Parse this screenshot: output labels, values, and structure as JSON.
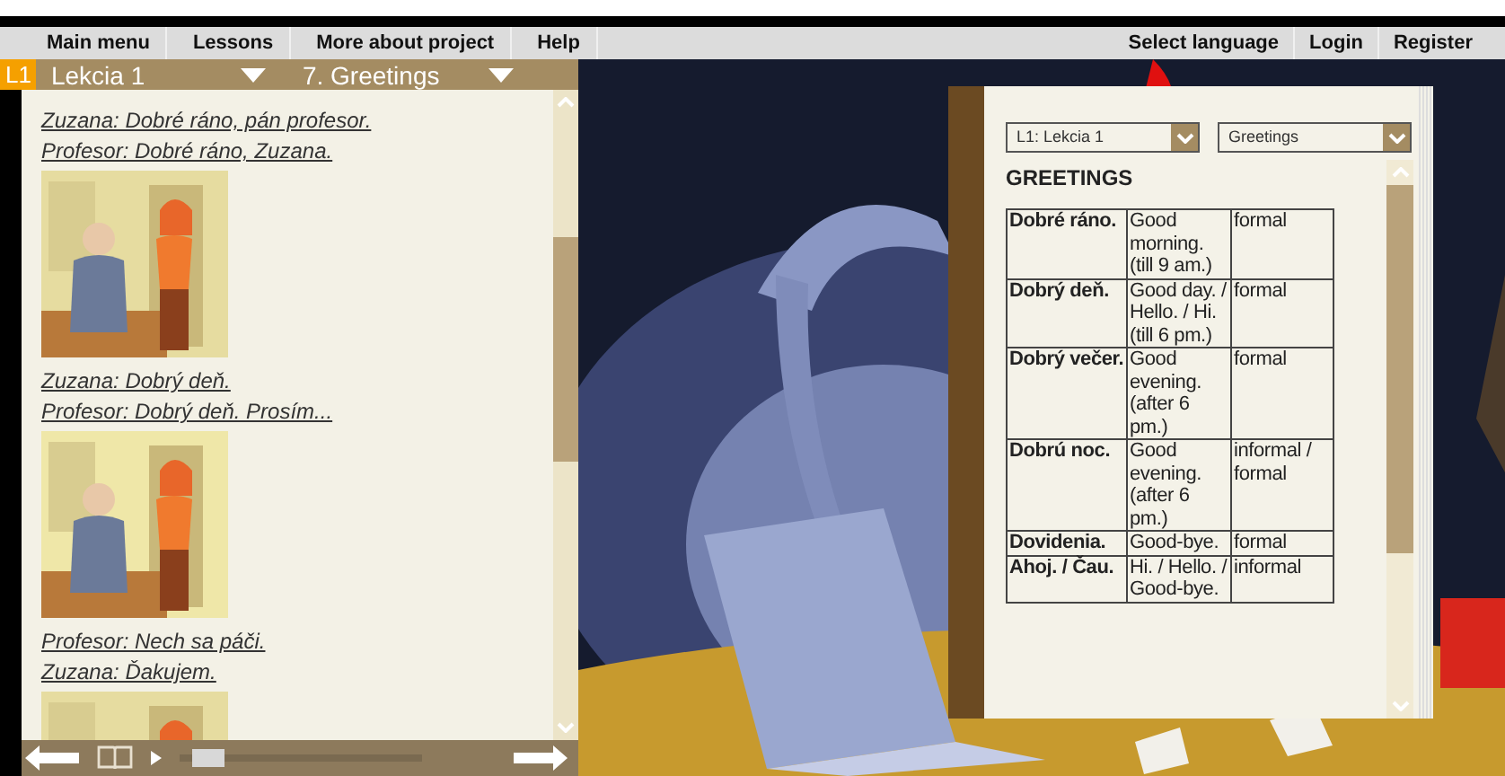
{
  "menu": {
    "left": [
      "Main menu",
      "Lessons",
      "More about project",
      "Help"
    ],
    "right": [
      "Select language",
      "Login",
      "Register"
    ]
  },
  "lesson_bar": {
    "badge": "L1",
    "lesson": "Lekcia 1",
    "topic": "7. Greetings"
  },
  "dialogue": [
    {
      "kind": "line",
      "text": "Zuzana: Dobré ráno, pán profesor."
    },
    {
      "kind": "line",
      "text": "Profesor: Dobré ráno, Zuzana."
    },
    {
      "kind": "picture"
    },
    {
      "kind": "line",
      "text": "Zuzana: Dobrý deň."
    },
    {
      "kind": "line",
      "text": "Profesor: Dobrý deň. Prosím..."
    },
    {
      "kind": "picture"
    },
    {
      "kind": "line",
      "text": "Profesor: Nech sa páči."
    },
    {
      "kind": "line",
      "text": "Zuzana: Ďakujem."
    },
    {
      "kind": "picture"
    }
  ],
  "player": {
    "level": 0.05
  },
  "book": {
    "lesson_select": "L1: Lekcia 1",
    "topic_select": "Greetings",
    "heading": "GREETINGS",
    "rows": [
      [
        "Dobré ráno.",
        "Good morning. (till 9 am.)",
        "formal"
      ],
      [
        "Dobrý deň.",
        "Good day. / Hello. / Hi. (till 6 pm.)",
        "formal"
      ],
      [
        "Dobrý večer.",
        "Good evening. (after 6 pm.)",
        "formal"
      ],
      [
        "Dobrú noc.",
        "Good evening. (after 6 pm.)",
        "informal / formal"
      ],
      [
        "Dovidenia.",
        "Good-bye.",
        "formal"
      ],
      [
        "Ahoj. / Čau.",
        "Hi. / Hello. / Good-bye.",
        "informal"
      ]
    ]
  }
}
